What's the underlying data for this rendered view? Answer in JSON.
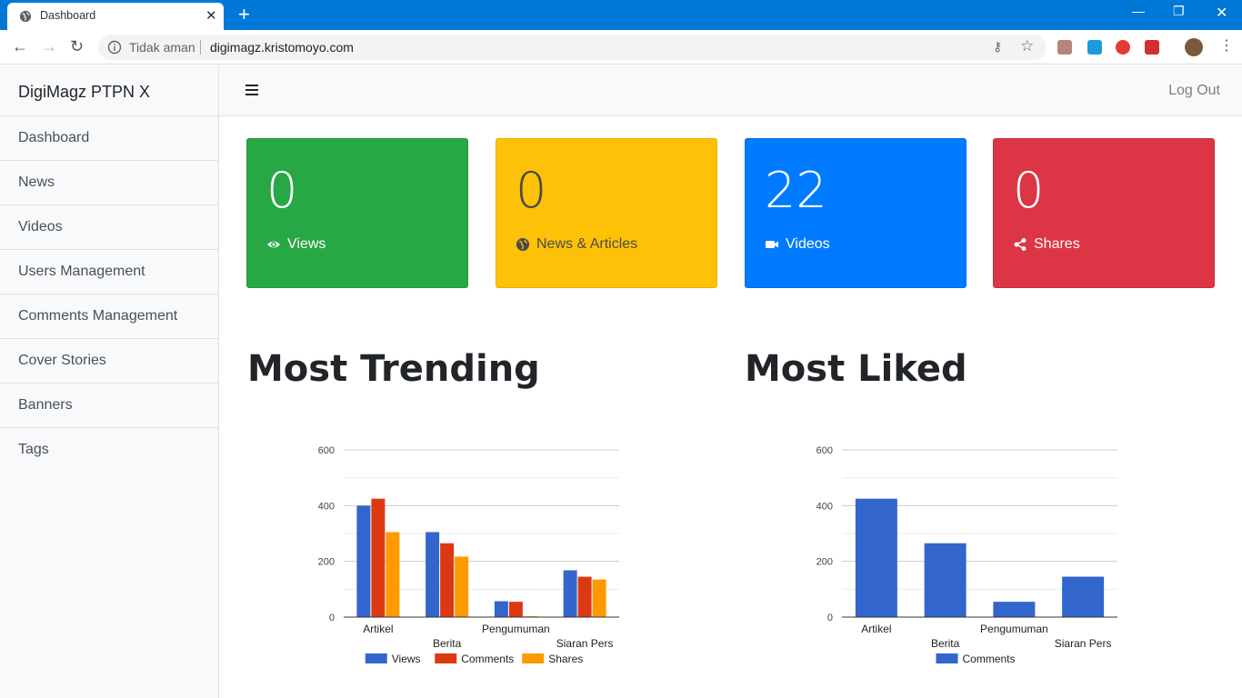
{
  "browser": {
    "tab_title": "Dashboard",
    "security_label": "Tidak aman",
    "url": "digimagz.kristomoyo.com"
  },
  "sidebar": {
    "brand": "DigiMagz PTPN X",
    "items": [
      {
        "label": "Dashboard"
      },
      {
        "label": "News"
      },
      {
        "label": "Videos"
      },
      {
        "label": "Users Management"
      },
      {
        "label": "Comments Management"
      },
      {
        "label": "Cover Stories"
      },
      {
        "label": "Banners"
      },
      {
        "label": "Tags"
      }
    ]
  },
  "topnav": {
    "logout_label": "Log Out"
  },
  "cards": [
    {
      "value": "0",
      "label": "Views",
      "icon": "eye-icon",
      "color": "#28a745",
      "text_color": "#ffffff"
    },
    {
      "value": "0",
      "label": "News & Articles",
      "icon": "globe-icon",
      "color": "#ffc107",
      "text_color": "#4a4a4a"
    },
    {
      "value": "22",
      "label": "Videos",
      "icon": "video-camera-icon",
      "color": "#007bff",
      "text_color": "#ffffff"
    },
    {
      "value": "0",
      "label": "Shares",
      "icon": "share-icon",
      "color": "#dc3545",
      "text_color": "#ffffff"
    }
  ],
  "sections": {
    "trending_title": "Most Trending",
    "liked_title": "Most Liked"
  },
  "chart_data": [
    {
      "type": "bar",
      "categories": [
        "Artikel",
        "Berita",
        "Pengumuman",
        "Siaran Pers"
      ],
      "series": [
        {
          "name": "Views",
          "color": "#3366cc",
          "values": [
            400,
            305,
            57,
            168
          ]
        },
        {
          "name": "Comments",
          "color": "#dc3912",
          "values": [
            425,
            265,
            55,
            145
          ]
        },
        {
          "name": "Shares",
          "color": "#ff9900",
          "values": [
            305,
            217,
            3,
            135
          ]
        }
      ],
      "yticks": [
        "0",
        "200",
        "400",
        "600"
      ],
      "ylim": [
        0,
        600
      ],
      "grid": true,
      "legend": "bottom"
    },
    {
      "type": "bar",
      "categories": [
        "Artikel",
        "Berita",
        "Pengumuman",
        "Siaran Pers"
      ],
      "series": [
        {
          "name": "Comments",
          "color": "#3366cc",
          "values": [
            425,
            265,
            55,
            145
          ]
        }
      ],
      "yticks": [
        "0",
        "200",
        "400",
        "600"
      ],
      "ylim": [
        0,
        600
      ],
      "grid": true,
      "legend": "bottom"
    }
  ]
}
